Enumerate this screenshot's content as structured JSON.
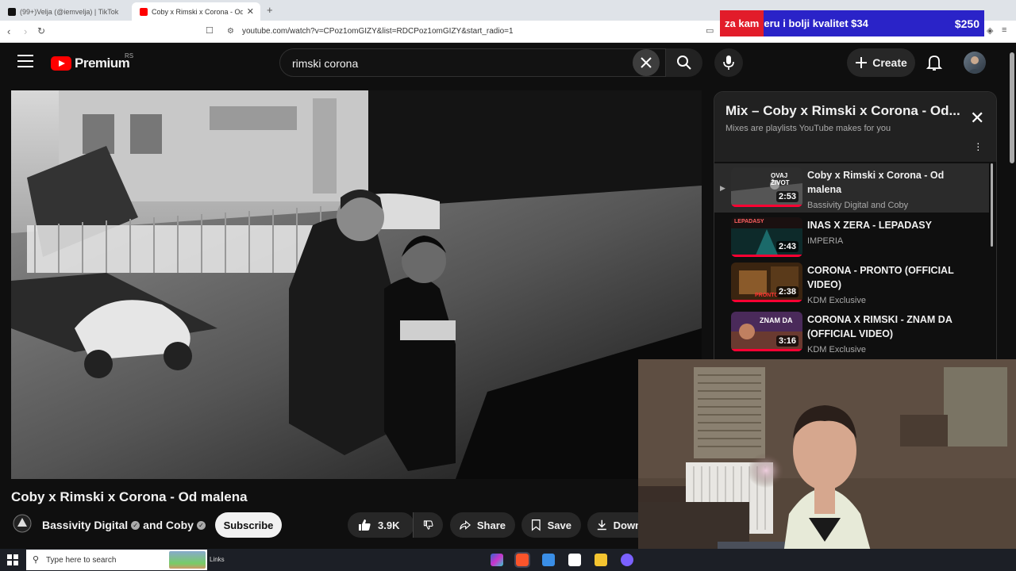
{
  "browser": {
    "tabs": [
      {
        "label": "(99+)Velja (@iemvelja) | TikTok",
        "active": false
      },
      {
        "label": "Coby x Rimski x Corona - Od malena",
        "active": true
      }
    ],
    "url": "youtube.com/watch?v=CPoz1omGIZY&list=RDCPoz1omGIZY&start_radio=1",
    "ad": {
      "text_highlight": "za kam",
      "text": "eru i bolji kvalitet $34",
      "price": "$250"
    }
  },
  "header": {
    "logo_text": "Premium",
    "logo_region": "RS",
    "search_value": "rimski corona",
    "create_label": "Create"
  },
  "video": {
    "title": "Coby x Rimski x Corona - Od malena",
    "channel": "Bassivity Digital",
    "channel_and": "and Coby",
    "subscribe_label": "Subscribe",
    "likes": "3.9K",
    "share_label": "Share",
    "save_label": "Save",
    "download_label": "Down"
  },
  "mix": {
    "title": "Mix – Coby x Rimski x Corona - Od...",
    "subtitle": "Mixes are playlists YouTube makes for you",
    "items": [
      {
        "title_line1": "Coby x Rimski x Corona - Od",
        "title_line2": "malena",
        "channel": "Bassivity Digital and Coby",
        "duration": "2:53",
        "thumb_caption": "OVAJ ŽIVOT",
        "current": true
      },
      {
        "title_line1": "INAS X ZERA - LEPADASY",
        "title_line2": "",
        "channel": "IMPERIA",
        "duration": "2:43",
        "thumb_caption": "LEPADASY",
        "current": false
      },
      {
        "title_line1": "CORONA - PRONTO (OFFICIAL",
        "title_line2": "VIDEO)",
        "channel": "KDM Exclusive",
        "duration": "2:38",
        "thumb_caption": "PRONTO",
        "current": false
      },
      {
        "title_line1": "CORONA X RIMSKI - ZNAM DA",
        "title_line2": "(OFFICIAL VIDEO)",
        "channel": "KDM Exclusive",
        "duration": "3:16",
        "thumb_caption": "ZNAM DA",
        "current": false
      }
    ]
  },
  "taskbar": {
    "search_placeholder": "Type here to search",
    "links_label": "Links"
  },
  "colors": {
    "yt_red": "#ff0000",
    "background": "#0f0f0f",
    "ad_blue": "#2a23c8",
    "ad_red": "#e21c2a"
  }
}
